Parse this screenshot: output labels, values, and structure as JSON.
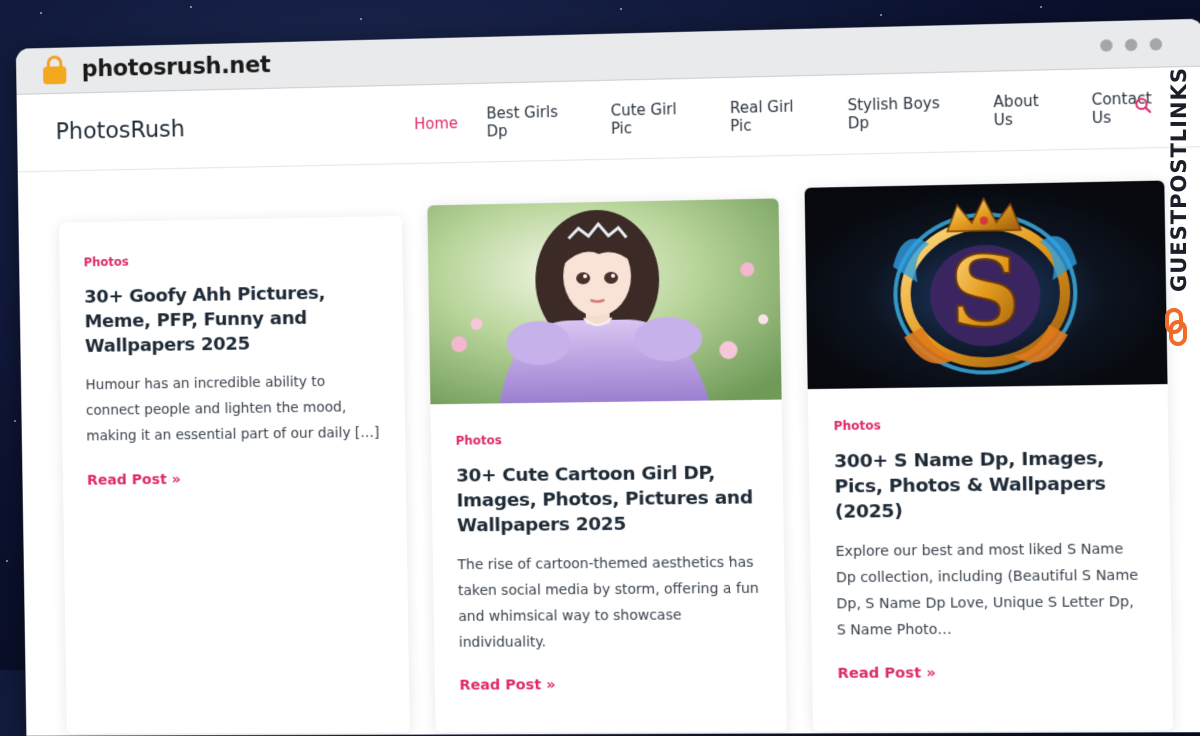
{
  "browser": {
    "url": "photosrush.net"
  },
  "site": {
    "logo": "PhotosRush",
    "nav": [
      {
        "label": "Home",
        "active": true
      },
      {
        "label": "Best Girls Dp"
      },
      {
        "label": "Cute Girl Pic"
      },
      {
        "label": "Real Girl Pic"
      },
      {
        "label": "Stylish Boys Dp"
      },
      {
        "label": "About Us"
      },
      {
        "label": "Contact Us"
      }
    ],
    "accent_color": "#e0296b"
  },
  "posts": [
    {
      "category": "Photos",
      "title": "30+ Goofy Ahh Pictures, Meme, PFP, Funny and Wallpapers 2025",
      "excerpt": "Humour has an incredible ability to connect people and lighten the mood, making it an essential part of our daily […]",
      "read_more": "Read Post »"
    },
    {
      "category": "Photos",
      "title": "30+ Cute Cartoon Girl DP, Images, Photos, Pictures and Wallpapers 2025",
      "excerpt": "The rise of cartoon-themed aesthetics has taken social media by storm, offering a fun and whimsical way to showcase individuality.",
      "read_more": "Read Post »"
    },
    {
      "category": "Photos",
      "title": "300+ S Name Dp, Images, Pics, Photos & Wallpapers (2025)",
      "excerpt": "Explore our best and most liked S Name Dp collection, including (Beautiful S Name Dp, S Name Dp Love, Unique S Letter Dp, S Name Photo…",
      "read_more": "Read Post »"
    }
  ],
  "watermark": {
    "text": "GUESTPOSTLINKS"
  }
}
